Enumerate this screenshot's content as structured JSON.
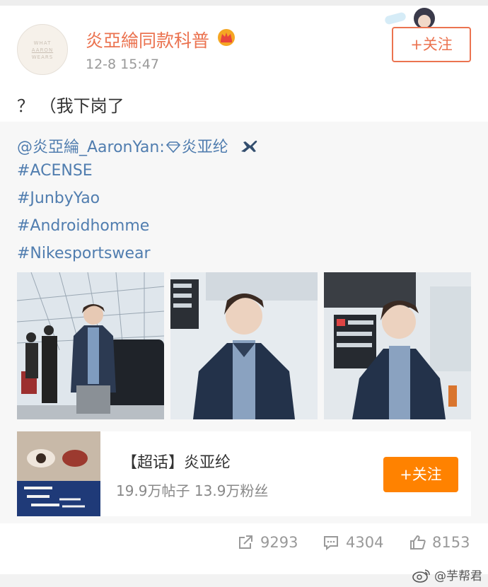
{
  "post": {
    "username": "炎亞綸同款科普",
    "time": "12-8 15:47",
    "follow_label": "+关注",
    "text": "？ （我下岗了",
    "avatar_text": [
      "WHAT",
      "AARON",
      "WEARS"
    ]
  },
  "repost": {
    "mention": "@炎亞綸_AaronYan:",
    "mention_name": "炎亚纶",
    "hashtags": [
      "#ACENSE",
      "#JunbyYao",
      "#Androidhomme",
      "#Nikesportswear"
    ]
  },
  "topic": {
    "title": "【超话】炎亚纶",
    "subtitle": "19.9万帖子 13.9万粉丝",
    "follow_label": "+关注"
  },
  "actions": {
    "repost_count": "9293",
    "comment_count": "4304",
    "like_count": "8153"
  },
  "watermark": "@芋帮君",
  "colors": {
    "accent": "#eb7350",
    "link": "#507daf",
    "follow_fill": "#ff8200"
  }
}
